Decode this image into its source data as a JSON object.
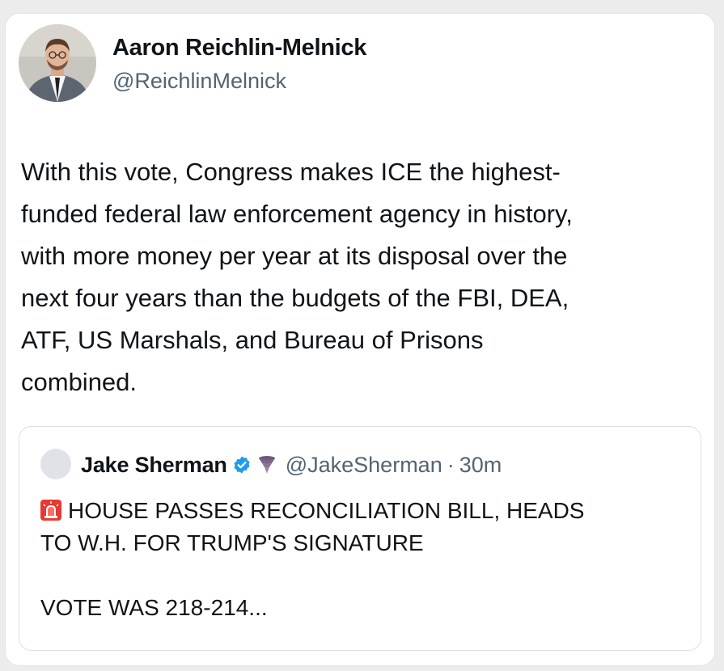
{
  "tweet": {
    "author_name": "Aaron Reichlin-Melnick",
    "author_handle": "@ReichlinMelnick",
    "text_lines": [
      "With this vote, Congress makes ICE the highest-",
      "funded federal law enforcement agency in history,",
      "with more money per year at its disposal over the",
      "next four years than the budgets of the FBI, DEA,",
      "ATF, US Marshals, and Bureau of Prisons",
      "combined."
    ]
  },
  "quote": {
    "author_name": "Jake Sherman",
    "author_handle": "@JakeSherman",
    "separator": "·",
    "time": "30m",
    "body_lines": [
      "HOUSE PASSES RECONCILIATION BILL, HEADS",
      "TO W.H. FOR TRUMP'S SIGNATURE",
      "",
      "VOTE WAS 218-214..."
    ]
  },
  "colors": {
    "text_primary": "#0f1419",
    "text_secondary": "#536471",
    "verified_blue": "#1d9bf0",
    "siren_red": "#e53935"
  },
  "icons": {
    "verified": "verified-badge-icon",
    "tornado": "tornado-icon",
    "siren": "siren-icon"
  }
}
